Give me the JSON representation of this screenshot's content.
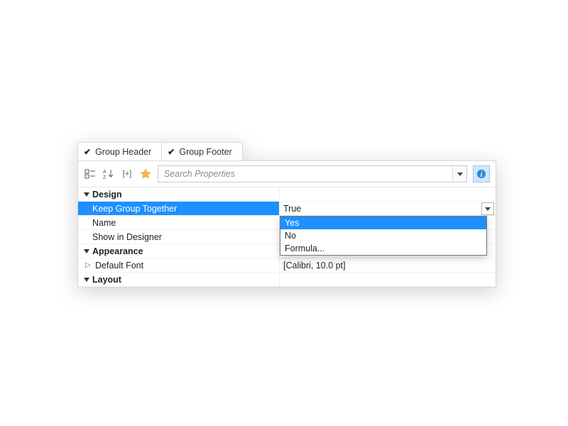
{
  "tabs": [
    {
      "label": "Group Header",
      "checked": true
    },
    {
      "label": "Group Footer",
      "checked": true
    }
  ],
  "toolbar": {
    "search_placeholder": "Search Properties",
    "icons": {
      "categorized": "categorized-icon",
      "alphabetical": "alphabetical-icon",
      "expand": "expand-icon",
      "favorites": "favorites-icon",
      "search_dropdown": "chevron-down-icon",
      "info": "info-icon"
    }
  },
  "grid": {
    "categories": [
      {
        "label": "Design",
        "expanded": true,
        "rows": [
          {
            "name": "Keep Group Together",
            "value": "True",
            "selected": true,
            "has_dropdown": true
          },
          {
            "name": "Name",
            "value": ""
          },
          {
            "name": "Show in Designer",
            "value": ""
          }
        ]
      },
      {
        "label": "Appearance",
        "expanded": true,
        "rows": [
          {
            "name": "Default Font",
            "value": "[Calibri, 10.0 pt]",
            "expandable": true
          }
        ]
      },
      {
        "label": "Layout",
        "expanded": true,
        "rows": []
      }
    ]
  },
  "dropdown": {
    "options": [
      "Yes",
      "No",
      "Formula..."
    ],
    "selected_index": 0
  }
}
